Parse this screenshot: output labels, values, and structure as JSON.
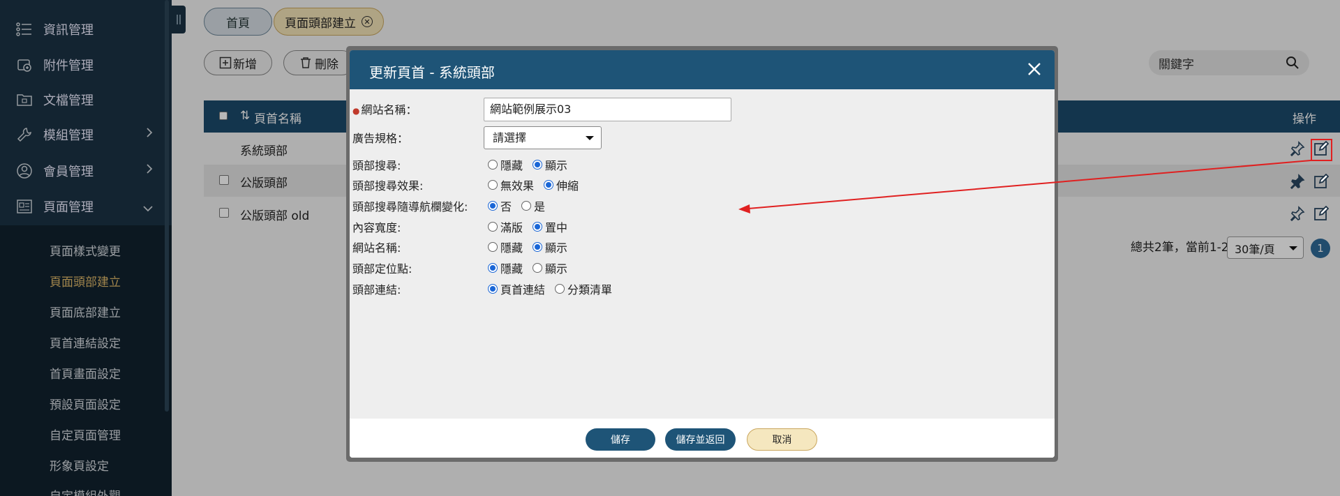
{
  "sidebar": {
    "items": [
      {
        "label": "資訊管理",
        "icon": "list-icon"
      },
      {
        "label": "附件管理",
        "icon": "attachment-icon"
      },
      {
        "label": "文檔管理",
        "icon": "folder-icon"
      },
      {
        "label": "模組管理",
        "icon": "wrench-icon"
      },
      {
        "label": "會員管理",
        "icon": "user-icon"
      },
      {
        "label": "頁面管理",
        "icon": "page-icon"
      }
    ],
    "sub_items": [
      {
        "label": "頁面樣式變更"
      },
      {
        "label": "頁面頭部建立"
      },
      {
        "label": "頁面底部建立"
      },
      {
        "label": "頁首連結設定"
      },
      {
        "label": "首頁畫面設定"
      },
      {
        "label": "預設頁面設定"
      },
      {
        "label": "自定頁面管理"
      },
      {
        "label": "形象頁設定"
      },
      {
        "label": "自定模組外觀"
      }
    ]
  },
  "tabs": {
    "home": "首頁",
    "active": "頁面頭部建立"
  },
  "toolbar": {
    "add": "新增",
    "delete": "刪除",
    "search_placeholder": "關鍵字"
  },
  "table": {
    "col_name": "頁首名稱",
    "col_ops": "操作",
    "rows": [
      {
        "name": "系統頭部"
      },
      {
        "name": "公版頭部"
      },
      {
        "name": "公版頭部 old"
      }
    ],
    "pager_text": "總共2筆，當前1-2",
    "page_size": "30筆/頁",
    "page_num": "1"
  },
  "modal": {
    "title": "更新頁首 - 系統頭部",
    "fields": {
      "site_name_label": "網站名稱：",
      "site_name_value": "網站範例展示03",
      "ad_spec_label": "廣告規格：",
      "ad_spec_value": "請選擇",
      "header_search_label": "頭部搜尋:",
      "header_search_effect_label": "頭部搜尋效果:",
      "search_follow_nav_label": "頭部搜尋隨導航欄變化:",
      "content_width_label": "內容寬度:",
      "site_name2_label": "網站名稱:",
      "anchor_label": "頭部定位點:",
      "header_link_label": "頭部連結:"
    },
    "radios": {
      "header_search": [
        {
          "label": "隱藏"
        },
        {
          "label": "顯示",
          "checked": true
        }
      ],
      "search_effect": [
        {
          "label": "無效果"
        },
        {
          "label": "伸縮",
          "checked": true
        }
      ],
      "follow_nav": [
        {
          "label": "否",
          "checked": true
        },
        {
          "label": "是"
        }
      ],
      "content_width": [
        {
          "label": "滿版"
        },
        {
          "label": "置中",
          "checked": true
        }
      ],
      "site_name": [
        {
          "label": "隱藏"
        },
        {
          "label": "顯示",
          "checked": true
        }
      ],
      "anchor": [
        {
          "label": "隱藏",
          "checked": true
        },
        {
          "label": "顯示"
        }
      ],
      "header_link": [
        {
          "label": "頁首連結",
          "checked": true
        },
        {
          "label": "分類清單"
        }
      ]
    },
    "buttons": {
      "save": "儲存",
      "save_return": "儲存並返回",
      "cancel": "取消"
    }
  },
  "colors": {
    "sidebar": "#1b3244",
    "accent": "#1e5477",
    "active_tab": "#f3e3b8",
    "annotation": "#e02020"
  }
}
